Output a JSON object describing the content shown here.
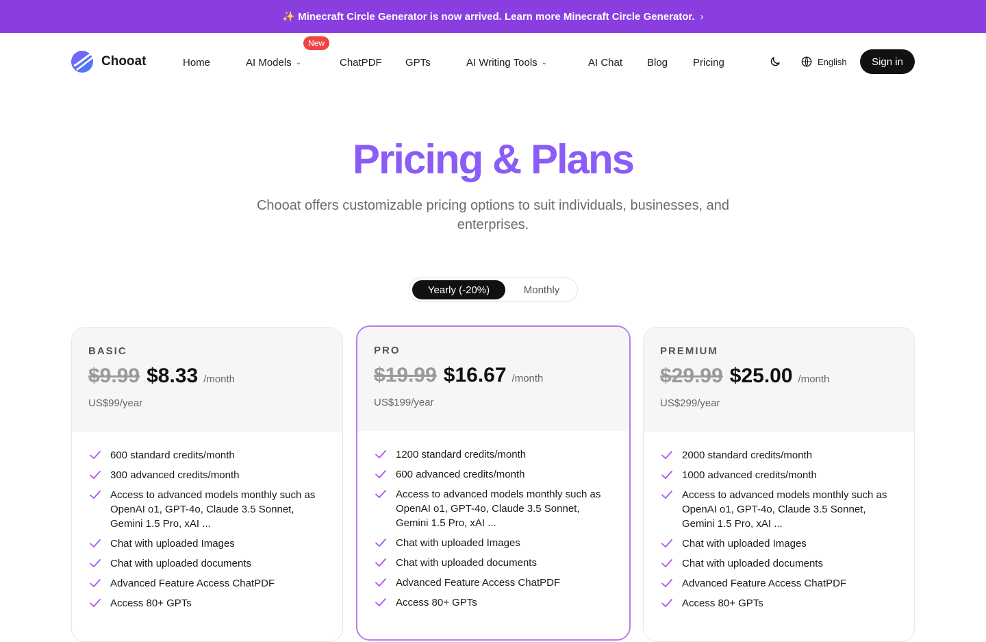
{
  "banner": {
    "text": "✨ Minecraft Circle Generator is now arrived. Learn more Minecraft Circle Generator.",
    "chevron": "›"
  },
  "nav": {
    "logo_text": "Chooat",
    "items": [
      {
        "label": "Home"
      },
      {
        "label": "AI Models",
        "dropdown": true,
        "badge": "New"
      },
      {
        "label": "ChatPDF"
      },
      {
        "label": "GPTs"
      },
      {
        "label": "AI Writing Tools",
        "dropdown": true
      },
      {
        "label": "AI Chat"
      },
      {
        "label": "Blog"
      },
      {
        "label": "Pricing"
      }
    ],
    "theme_icon": "moon-icon",
    "language": "English",
    "signin": "Sign in"
  },
  "hero": {
    "title": "Pricing & Plans",
    "subtitle": "Chooat offers customizable pricing options to suit individuals, businesses, and enterprises."
  },
  "billing": {
    "yearly": "Yearly (-20%)",
    "monthly": "Monthly",
    "selected": "yearly"
  },
  "plans": [
    {
      "name": "BASIC",
      "old_price": "$9.99",
      "price": "$8.33",
      "per": "/month",
      "yearly": "US$99/year",
      "features": [
        "600 standard credits/month",
        "300 advanced credits/month",
        "Access to advanced models monthly such as OpenAI o1, GPT-4o, Claude 3.5 Sonnet, Gemini 1.5 Pro, xAI ...",
        "Chat with uploaded Images",
        "Chat with uploaded documents",
        "Advanced Feature Access ChatPDF",
        "Access 80+ GPTs"
      ]
    },
    {
      "name": "PRO",
      "old_price": "$19.99",
      "price": "$16.67",
      "per": "/month",
      "yearly": "US$199/year",
      "features": [
        "1200 standard credits/month",
        "600 advanced credits/month",
        "Access to advanced models monthly such as OpenAI o1, GPT-4o, Claude 3.5 Sonnet, Gemini 1.5 Pro, xAI ...",
        "Chat with uploaded Images",
        "Chat with uploaded documents",
        "Advanced Feature Access ChatPDF",
        "Access 80+ GPTs"
      ]
    },
    {
      "name": "PREMIUM",
      "old_price": "$29.99",
      "price": "$25.00",
      "per": "/month",
      "yearly": "US$299/year",
      "features": [
        "2000 standard credits/month",
        "1000 advanced credits/month",
        "Access to advanced models monthly such as OpenAI o1, GPT-4o, Claude 3.5 Sonnet, Gemini 1.5 Pro, xAI ...",
        "Chat with uploaded Images",
        "Chat with uploaded documents",
        "Advanced Feature Access ChatPDF",
        "Access 80+ GPTs"
      ]
    }
  ],
  "colors": {
    "banner_bg": "#8a3ee0",
    "accent_purple": "#8b5cf6",
    "check_purple": "#a855f7",
    "featured_border": "#b57ee6",
    "badge_red": "#ef4444"
  }
}
